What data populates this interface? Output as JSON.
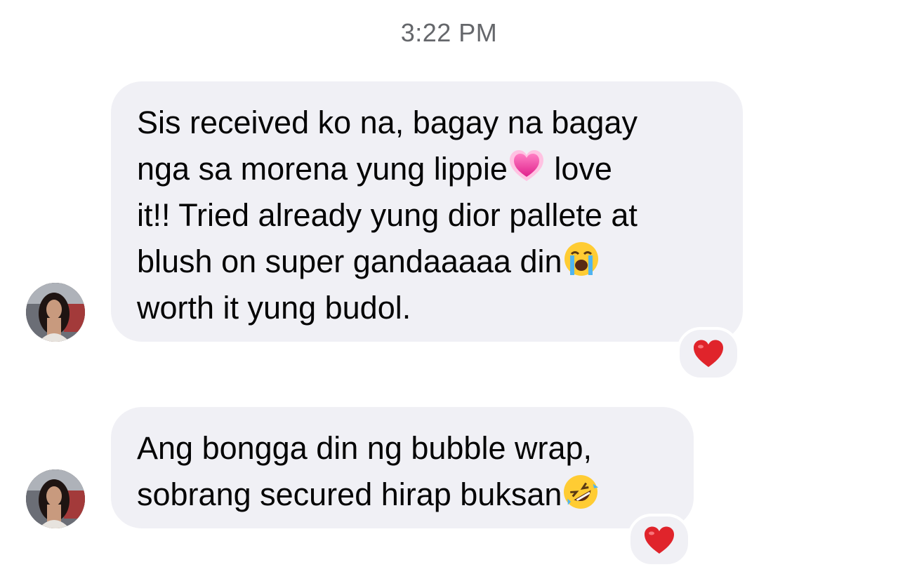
{
  "conversation": {
    "timestamp": "3:22 PM",
    "messages": [
      {
        "sender_avatar": "contact-avatar-photo",
        "lines": [
          {
            "text": "Sis received ko na, bagay na bagay",
            "emoji": ""
          },
          {
            "text": "nga sa morena yung lippie",
            "emoji": "growing-heart-emoji",
            "after": " love"
          },
          {
            "text": "it!! Tried already yung dior pallete at",
            "emoji": ""
          },
          {
            "text": "blush on super gandaaaaa din",
            "emoji": "loudly-crying-face-emoji"
          },
          {
            "text": "worth it yung budol.",
            "emoji": ""
          }
        ],
        "reaction": "red-heart-emoji"
      },
      {
        "sender_avatar": "contact-avatar-photo",
        "lines": [
          {
            "text": "Ang bongga din ng bubble wrap,",
            "emoji": ""
          },
          {
            "text": "sobrang secured hirap buksan",
            "emoji": "rolling-on-floor-laughing-emoji"
          }
        ],
        "reaction": "red-heart-emoji"
      }
    ]
  },
  "colors": {
    "bubble_background": "#f0f0f5",
    "timestamp_text": "#65676b",
    "message_text": "#050505",
    "reaction_heart": "#e0242b"
  }
}
